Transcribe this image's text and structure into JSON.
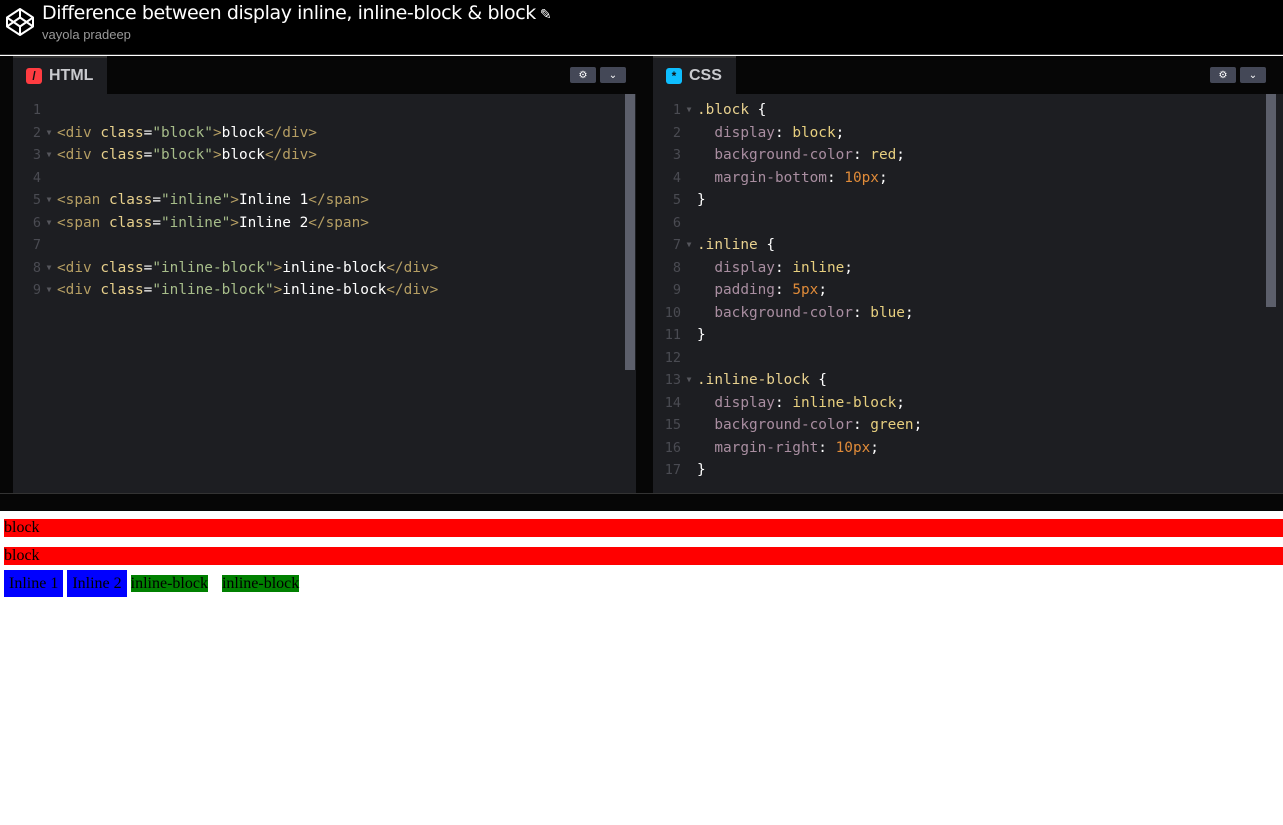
{
  "header": {
    "title": "Difference between display inline, inline-block & block",
    "author": "vayola pradeep"
  },
  "html_panel": {
    "tab": "HTML",
    "lines": [
      [],
      [
        [
          "tag",
          "<div "
        ],
        [
          "attr",
          "class"
        ],
        [
          "punc",
          "="
        ],
        [
          "str",
          "\"block\""
        ],
        [
          "tag",
          ">"
        ],
        [
          "text",
          "block"
        ],
        [
          "tag",
          "</div>"
        ]
      ],
      [
        [
          "tag",
          "<div "
        ],
        [
          "attr",
          "class"
        ],
        [
          "punc",
          "="
        ],
        [
          "str",
          "\"block\""
        ],
        [
          "tag",
          ">"
        ],
        [
          "text",
          "block"
        ],
        [
          "tag",
          "</div>"
        ]
      ],
      [],
      [
        [
          "tag",
          "<span "
        ],
        [
          "attr",
          "class"
        ],
        [
          "punc",
          "="
        ],
        [
          "str",
          "\"inline\""
        ],
        [
          "tag",
          ">"
        ],
        [
          "text",
          "Inline 1"
        ],
        [
          "tag",
          "</span>"
        ]
      ],
      [
        [
          "tag",
          "<span "
        ],
        [
          "attr",
          "class"
        ],
        [
          "punc",
          "="
        ],
        [
          "str",
          "\"inline\""
        ],
        [
          "tag",
          ">"
        ],
        [
          "text",
          "Inline 2"
        ],
        [
          "tag",
          "</span>"
        ]
      ],
      [],
      [
        [
          "tag",
          "<div "
        ],
        [
          "attr",
          "class"
        ],
        [
          "punc",
          "="
        ],
        [
          "str",
          "\"inline-block\""
        ],
        [
          "tag",
          ">"
        ],
        [
          "text",
          "inline-block"
        ],
        [
          "tag",
          "</div>"
        ]
      ],
      [
        [
          "tag",
          "<div "
        ],
        [
          "attr",
          "class"
        ],
        [
          "punc",
          "="
        ],
        [
          "str",
          "\"inline-block\""
        ],
        [
          "tag",
          ">"
        ],
        [
          "text",
          "inline-block"
        ],
        [
          "tag",
          "</div>"
        ]
      ]
    ],
    "folds": [
      2,
      3,
      5,
      6,
      8,
      9
    ]
  },
  "css_panel": {
    "tab": "CSS",
    "lines": [
      [
        [
          "sel",
          ".block"
        ],
        [
          "punc",
          " {"
        ]
      ],
      [
        [
          "punc",
          "  "
        ],
        [
          "prop",
          "display"
        ],
        [
          "punc",
          ": "
        ],
        [
          "val",
          "block"
        ],
        [
          "punc",
          ";"
        ]
      ],
      [
        [
          "punc",
          "  "
        ],
        [
          "prop",
          "background-color"
        ],
        [
          "punc",
          ": "
        ],
        [
          "val",
          "red"
        ],
        [
          "punc",
          ";"
        ]
      ],
      [
        [
          "punc",
          "  "
        ],
        [
          "prop",
          "margin-bottom"
        ],
        [
          "punc",
          ": "
        ],
        [
          "num",
          "10px"
        ],
        [
          "punc",
          ";"
        ]
      ],
      [
        [
          "punc",
          "}"
        ]
      ],
      [],
      [
        [
          "sel",
          ".inline"
        ],
        [
          "punc",
          " {"
        ]
      ],
      [
        [
          "punc",
          "  "
        ],
        [
          "prop",
          "display"
        ],
        [
          "punc",
          ": "
        ],
        [
          "val",
          "inline"
        ],
        [
          "punc",
          ";"
        ]
      ],
      [
        [
          "punc",
          "  "
        ],
        [
          "prop",
          "padding"
        ],
        [
          "punc",
          ": "
        ],
        [
          "num",
          "5px"
        ],
        [
          "punc",
          ";"
        ]
      ],
      [
        [
          "punc",
          "  "
        ],
        [
          "prop",
          "background-color"
        ],
        [
          "punc",
          ": "
        ],
        [
          "val",
          "blue"
        ],
        [
          "punc",
          ";"
        ]
      ],
      [
        [
          "punc",
          "}"
        ]
      ],
      [],
      [
        [
          "sel",
          ".inline-block"
        ],
        [
          "punc",
          " {"
        ]
      ],
      [
        [
          "punc",
          "  "
        ],
        [
          "prop",
          "display"
        ],
        [
          "punc",
          ": "
        ],
        [
          "val",
          "inline-block"
        ],
        [
          "punc",
          ";"
        ]
      ],
      [
        [
          "punc",
          "  "
        ],
        [
          "prop",
          "background-color"
        ],
        [
          "punc",
          ": "
        ],
        [
          "val",
          "green"
        ],
        [
          "punc",
          ";"
        ]
      ],
      [
        [
          "punc",
          "  "
        ],
        [
          "prop",
          "margin-right"
        ],
        [
          "punc",
          ": "
        ],
        [
          "num",
          "10px"
        ],
        [
          "punc",
          ";"
        ]
      ],
      [
        [
          "punc",
          "}"
        ]
      ]
    ],
    "folds": [
      1,
      7,
      13
    ]
  },
  "preview": {
    "blocks": [
      "block",
      "block"
    ],
    "inlines": [
      "Inline 1",
      "Inline 2"
    ],
    "inline_blocks": [
      "inline-block",
      "inline-block"
    ]
  },
  "colors": {
    "html_icon": "#ff3c41",
    "css_icon": "#0ebeff"
  }
}
